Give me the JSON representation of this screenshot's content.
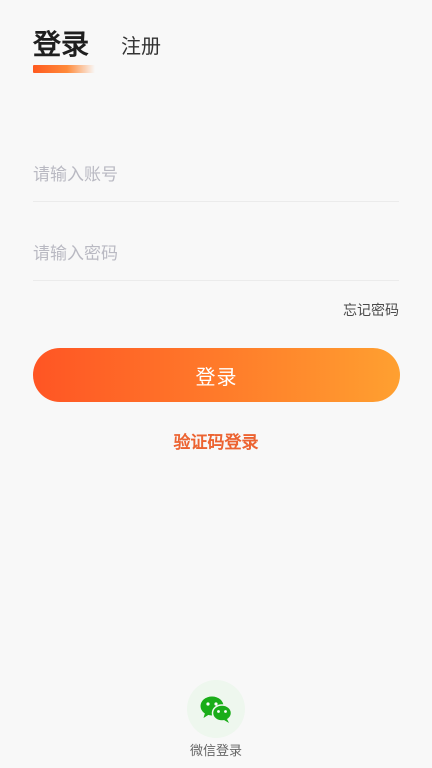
{
  "tabs": {
    "login": "登录",
    "register": "注册"
  },
  "form": {
    "account_placeholder": "请输入账号",
    "password_placeholder": "请输入密码",
    "forgot_password": "忘记密码"
  },
  "actions": {
    "login_button": "登录",
    "sms_login": "验证码登录"
  },
  "social": {
    "wechat_label": "微信登录",
    "wechat_icon": "wechat-icon"
  },
  "colors": {
    "accent": "#ff6a22",
    "accent_text": "#ec6331",
    "wechat_green": "#1aad19"
  }
}
